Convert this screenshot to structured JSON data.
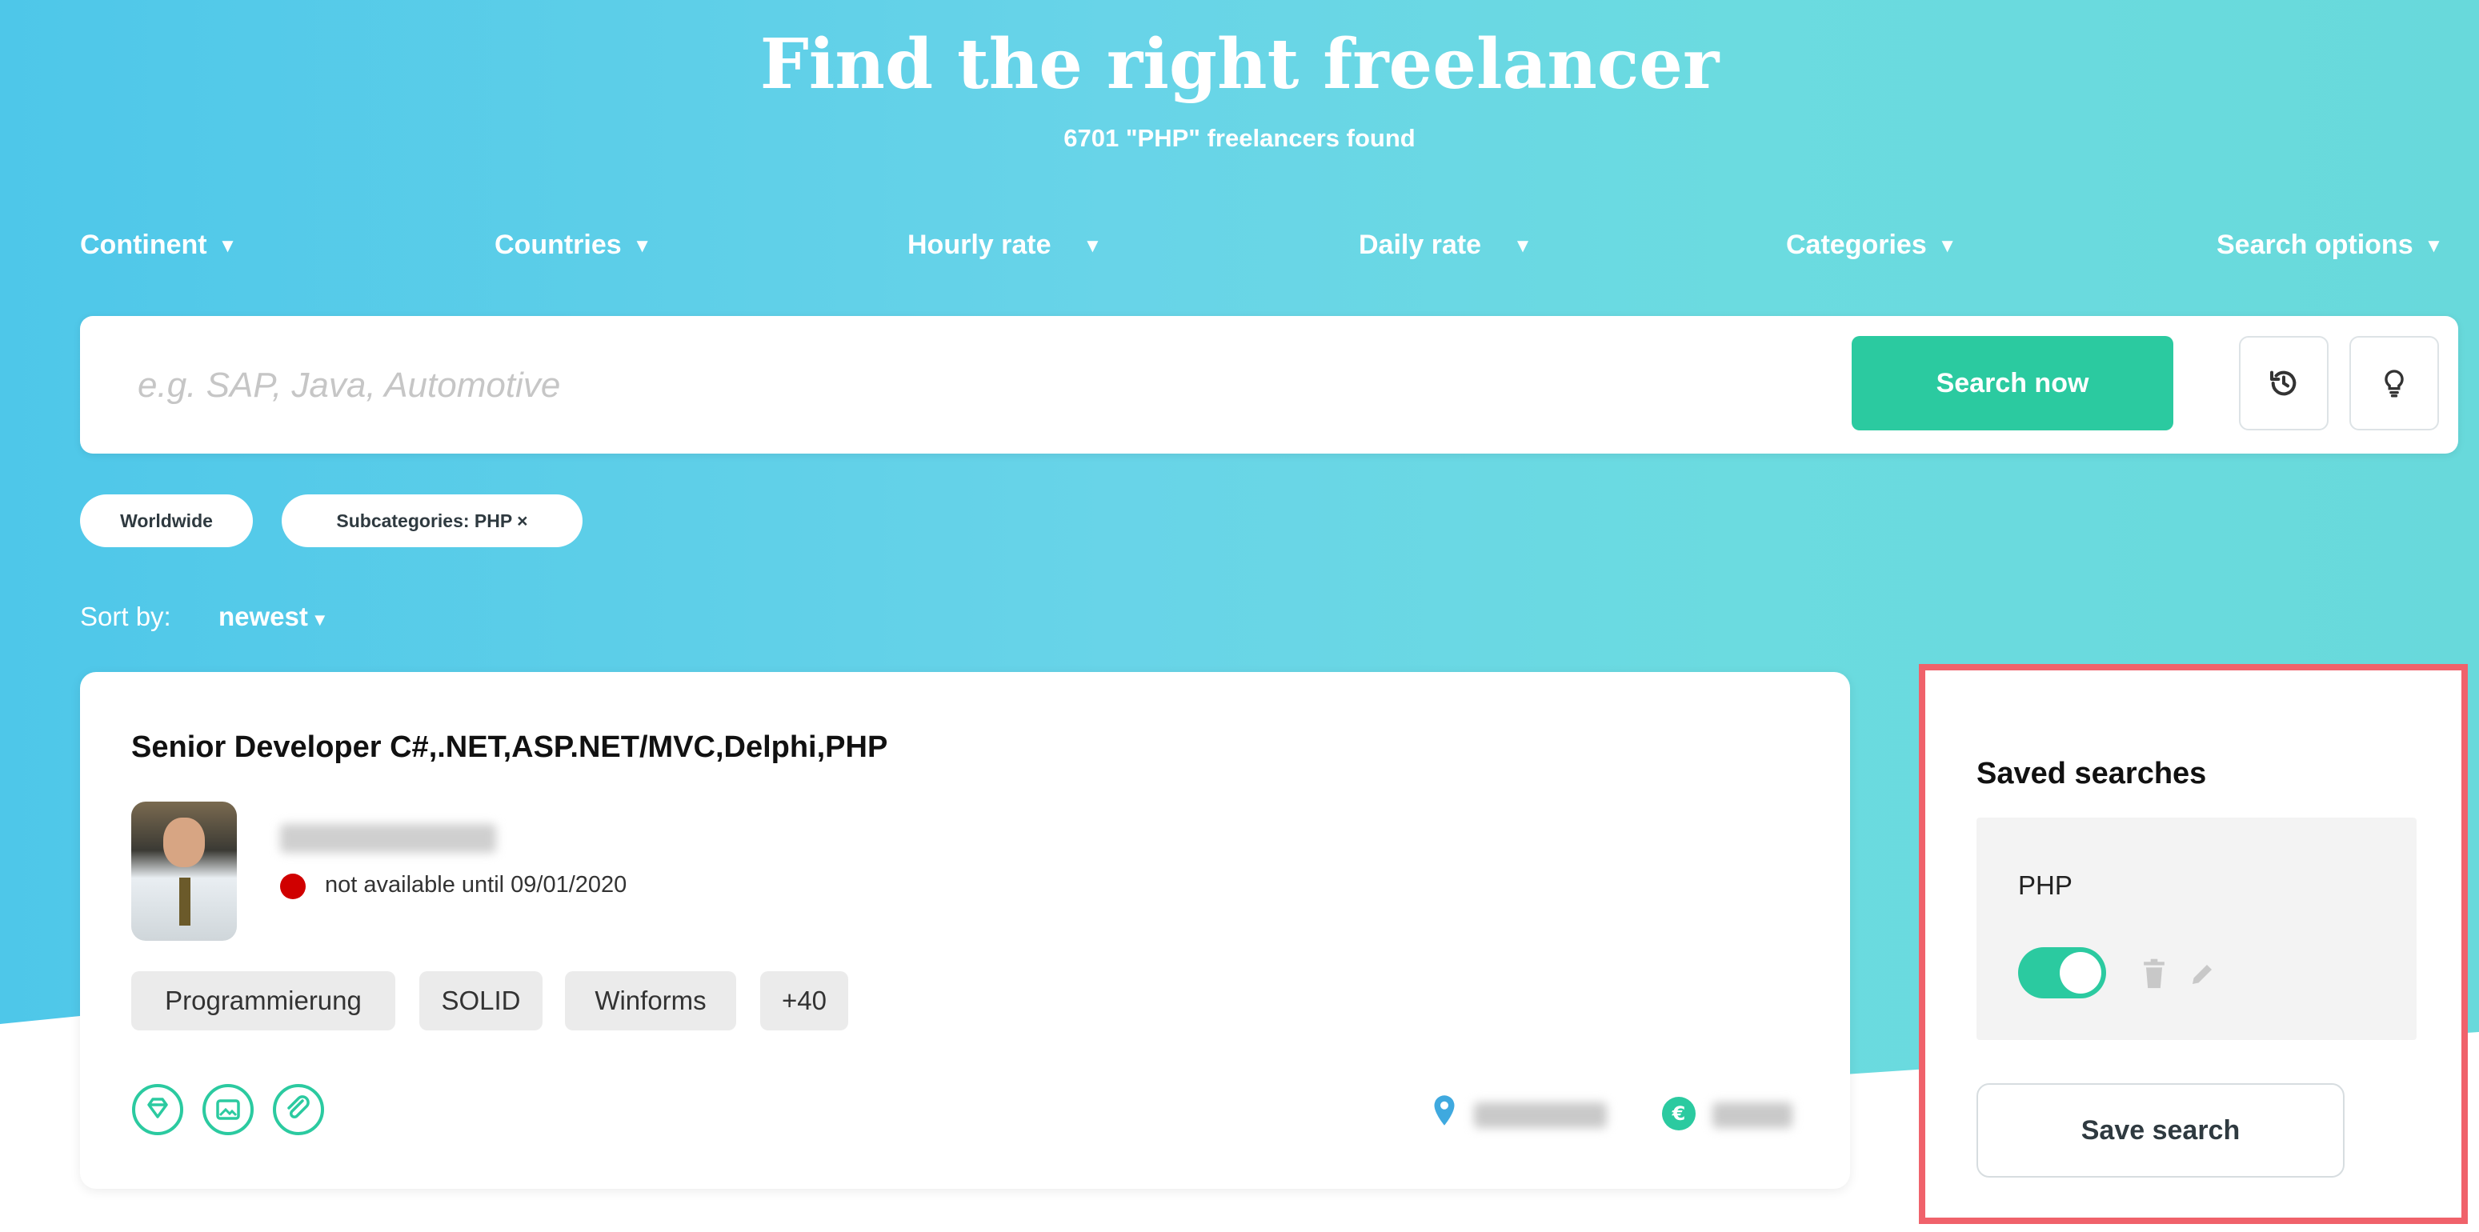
{
  "header": {
    "title": "Find the right freelancer",
    "subtitle": "6701 \"PHP\" freelancers found"
  },
  "filters": [
    {
      "label": "Continent"
    },
    {
      "label": "Countries"
    },
    {
      "label": "Hourly rate"
    },
    {
      "label": "Daily rate"
    },
    {
      "label": "Categories"
    },
    {
      "label": "Search options"
    }
  ],
  "search": {
    "placeholder": "e.g. SAP, Java, Automotive",
    "value": "",
    "button_label": "Search now",
    "history_icon": "history-icon",
    "tips_icon": "lightbulb-icon"
  },
  "active_chips": [
    {
      "label": "Worldwide"
    },
    {
      "label": "Subcategories: PHP ×"
    }
  ],
  "sort": {
    "label": "Sort by:",
    "value": "newest"
  },
  "result_card": {
    "title": "Senior Developer C#,.NET,ASP.NET/MVC,Delphi,PHP",
    "availability": "not available until 09/01/2020",
    "status_color": "#d00000",
    "tags": [
      "Programmierung",
      "SOLID",
      "Winforms",
      "+40"
    ],
    "feature_icons": [
      "diamond-icon",
      "image-icon",
      "paperclip-icon"
    ],
    "location_icon": "map-pin-icon",
    "rate_icon": "euro-icon"
  },
  "saved_searches": {
    "title": "Saved searches",
    "items": [
      {
        "name": "PHP",
        "active": true
      }
    ],
    "save_button_label": "Save search"
  },
  "colors": {
    "accent": "#2bcaa0",
    "highlight_border": "#f0626b",
    "hero_start": "#4ec7e9",
    "hero_end": "#68d9db"
  }
}
